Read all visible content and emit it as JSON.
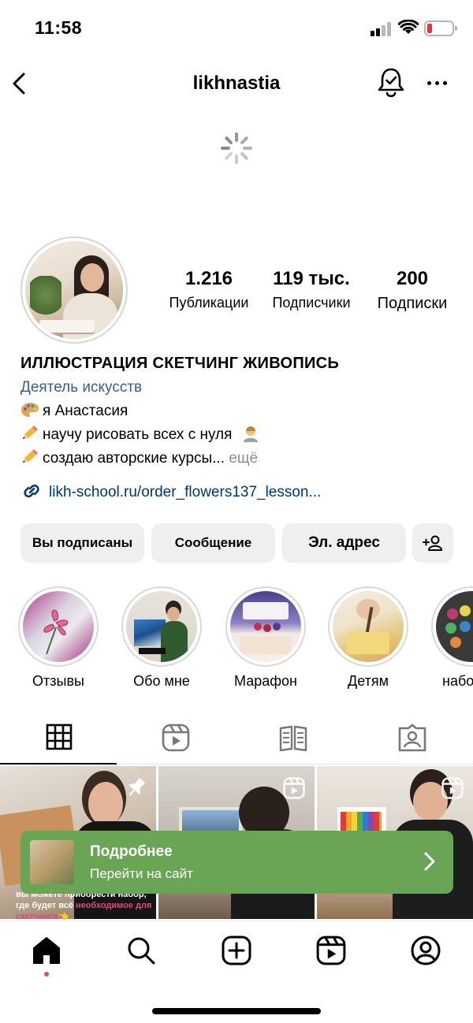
{
  "status": {
    "time": "11:58"
  },
  "header": {
    "username": "likhnastia"
  },
  "profile": {
    "stats": [
      {
        "value": "1.216",
        "label": "Публикации"
      },
      {
        "value": "119 тыс.",
        "label": "Подписчики"
      },
      {
        "value": "200",
        "label": "Подписки"
      }
    ],
    "name": "ИЛЛЮСТРАЦИЯ СКЕТЧИНГ ЖИВОПИСЬ",
    "category": "Деятель искусств",
    "bio_lines": [
      "я Анастасия",
      "научу рисовать всех с нуля",
      "создаю авторские курсы..."
    ],
    "bio_more": "ещё",
    "link": "likh-school.ru/order_flowers137_lesson..."
  },
  "buttons": {
    "following": "Вы подписаны",
    "message": "Сообщение",
    "email": "Эл. адрес"
  },
  "highlights": [
    {
      "label": "Отзывы"
    },
    {
      "label": "Обо мне"
    },
    {
      "label": "Марафон"
    },
    {
      "label": "Детям"
    },
    {
      "label": "набо"
    }
  ],
  "cta": {
    "title": "Подробнее",
    "subtitle": "Перейти на сайт"
  },
  "grid_caption": {
    "part1": "вы можете приобрести набор, где будет всё ",
    "highlight": "необходимое для скетчинга",
    "part2": "👈"
  },
  "colors": {
    "link": "#00376b",
    "category": "#385f86",
    "cta": "#6aa455",
    "notification_dot": "#ed4956"
  }
}
